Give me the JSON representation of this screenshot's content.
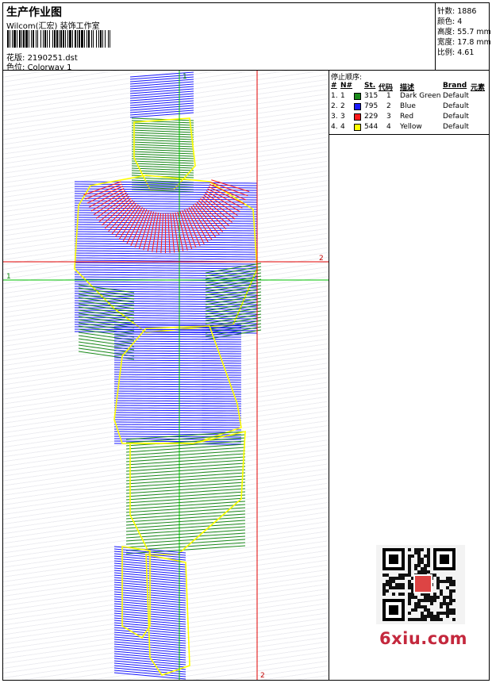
{
  "header": {
    "title": "生产作业图",
    "company": "Wilcom(汇宏) 装饰工作室",
    "design_label": "花版:",
    "design_value": "2190251.dst",
    "colorway_label": "色位:",
    "colorway_value": "Colorway 1"
  },
  "stats": {
    "stitches_label": "针数:",
    "stitches_value": "1886",
    "colors_label": "颜色:",
    "colors_value": "4",
    "height_label": "高度:",
    "height_value": "55.7 mm",
    "width_label": "宽度:",
    "width_value": "17.8 mm",
    "scale_label": "比例:",
    "scale_value": "4.61"
  },
  "guides": {
    "green_h": "1",
    "green_v": "1",
    "red_h": "2",
    "red_v": "2"
  },
  "sequence": {
    "title": "停止顺序:",
    "headers": {
      "idx": "#",
      "no": "N#",
      "st": "St.",
      "code": "代码",
      "desc": "描述",
      "brand": "Brand",
      "elem": "元素"
    },
    "rows": [
      {
        "idx": "1.",
        "no": "1",
        "st": "315",
        "code": "1",
        "desc": "Dark Green",
        "brand": "Default",
        "color": "#1a8a1a"
      },
      {
        "idx": "2.",
        "no": "2",
        "st": "795",
        "code": "2",
        "desc": "Blue",
        "brand": "Default",
        "color": "#1a1aff"
      },
      {
        "idx": "3.",
        "no": "3",
        "st": "229",
        "code": "3",
        "desc": "Red",
        "brand": "Default",
        "color": "#ff1a1a"
      },
      {
        "idx": "4.",
        "no": "4",
        "st": "544",
        "code": "4",
        "desc": "Yellow",
        "brand": "Default",
        "color": "#ffff00"
      }
    ]
  },
  "watermark": "6xiu.com"
}
